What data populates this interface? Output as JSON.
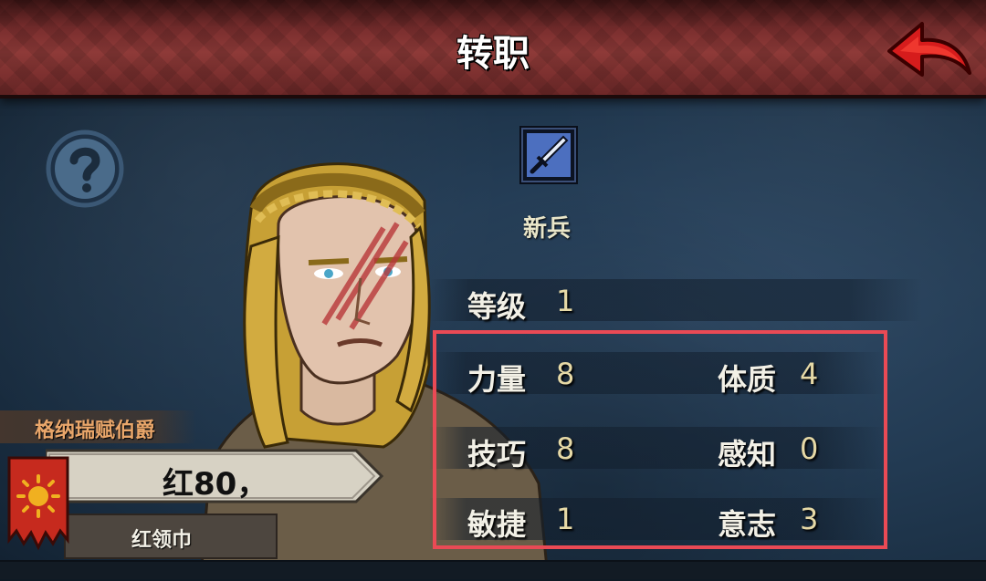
{
  "header": {
    "title": "转职"
  },
  "class": {
    "name": "新兵",
    "icon": "dagger-icon"
  },
  "level": {
    "label": "等级",
    "value": "1"
  },
  "stats": {
    "strength": {
      "label": "力量",
      "value": "8"
    },
    "constitution": {
      "label": "体质",
      "value": "4"
    },
    "skill": {
      "label": "技巧",
      "value": "8"
    },
    "perception": {
      "label": "感知",
      "value": "0"
    },
    "agility": {
      "label": "敏捷",
      "value": "1"
    },
    "willpower": {
      "label": "意志",
      "value": "3"
    }
  },
  "character": {
    "lord_title": "格纳瑞赋伯爵",
    "name": "红80，",
    "nickname": "红领巾"
  },
  "colors": {
    "header": "#7a2e2e",
    "highlight": "#ea4a55",
    "stat_value": "#e6d9a6",
    "lord_title": "#e9a66a"
  }
}
